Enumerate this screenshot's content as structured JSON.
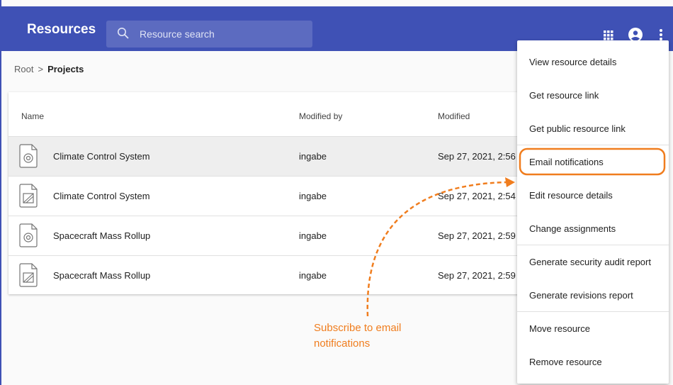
{
  "app": {
    "title": "Resources"
  },
  "search": {
    "placeholder": "Resource search"
  },
  "toolbar": {
    "icons": [
      "apps-icon",
      "account-circle-icon",
      "more-vert-icon"
    ]
  },
  "breadcrumb": {
    "root": "Root",
    "separator": ">",
    "current": "Projects"
  },
  "table": {
    "columns": [
      "Name",
      "Modified by",
      "Modified"
    ],
    "rows": [
      {
        "icon": "model-icon",
        "name": "Climate Control System",
        "modified_by": "ingabe",
        "modified": "Sep 27, 2021, 2:56"
      },
      {
        "icon": "image-icon",
        "name": "Climate Control System",
        "modified_by": "ingabe",
        "modified": "Sep 27, 2021, 2:54"
      },
      {
        "icon": "model-icon",
        "name": "Spacecraft Mass Rollup",
        "modified_by": "ingabe",
        "modified": "Sep 27, 2021, 2:59"
      },
      {
        "icon": "image-icon",
        "name": "Spacecraft Mass Rollup",
        "modified_by": "ingabe",
        "modified": "Sep 27, 2021, 2:59"
      }
    ]
  },
  "menu": {
    "items": [
      "View resource details",
      "Get resource link",
      "Get public resource link",
      "Email notifications",
      "Edit resource details",
      "Change assignments",
      "Generate security audit report",
      "Generate revisions report",
      "Move resource",
      "Remove resource"
    ]
  },
  "annotation": {
    "line1": "Subscribe to email",
    "line2": "notifications",
    "color": "#f07d1e"
  },
  "colors": {
    "appbar": "#3f51b5",
    "highlight": "#f07d1e"
  }
}
